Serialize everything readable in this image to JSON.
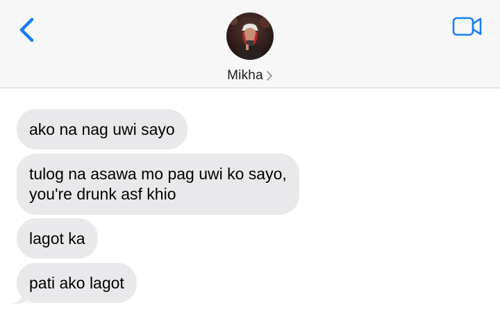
{
  "header": {
    "contact_name": "Mikha",
    "accent_color": "#147efb",
    "icons": {
      "back": "chevron-left-icon",
      "video": "video-camera-icon",
      "contact_chevron": "chevron-right-icon"
    }
  },
  "messages": [
    {
      "sender": "Mikha",
      "text": "ako na nag uwi sayo"
    },
    {
      "sender": "Mikha",
      "text": "tulog na asawa mo pag uwi ko sayo,\nyou're drunk asf khio"
    },
    {
      "sender": "Mikha",
      "text": "lagot ka"
    },
    {
      "sender": "Mikha",
      "text": "pati ako lagot"
    }
  ],
  "colors": {
    "incoming_bubble": "#e9e9eb",
    "header_bg": "#f7f7f7"
  }
}
